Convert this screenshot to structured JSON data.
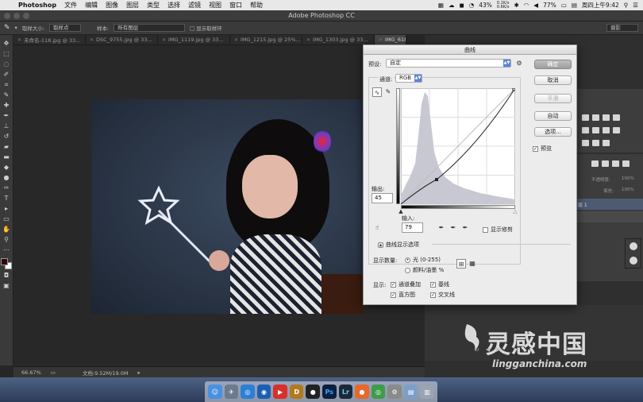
{
  "menubar": {
    "app_name": "Photoshop",
    "items": [
      "文件",
      "编辑",
      "图像",
      "图层",
      "类型",
      "选择",
      "滤镜",
      "视图",
      "窗口",
      "帮助"
    ],
    "battery_small": "43%",
    "net_up": "0.1K/s",
    "net_down": "0.6K/s",
    "battery": "77%",
    "clock": "周四上午9:42"
  },
  "titlebar": {
    "title": "Adobe Photoshop CC"
  },
  "options_bar": {
    "sample_size_label": "取样大小:",
    "sample_size_value": "取样点",
    "sample_label": "样本:",
    "sample_value": "所有图层",
    "show_ring_label": "显示取样环",
    "workspace": "摄影"
  },
  "tabs": [
    {
      "label": "未命名-118.jpg @ 33...",
      "active": false
    },
    {
      "label": "DSC_9755.jpg @ 33...",
      "active": false
    },
    {
      "label": "IMG_1119.jpg @ 33...",
      "active": false
    },
    {
      "label": "IMG_1215.jpg @ 25%...",
      "active": false
    },
    {
      "label": "IMG_1303.jpg @ 33...",
      "active": false
    },
    {
      "label": "IMG_6184.jp...",
      "active": true
    }
  ],
  "statusbar": {
    "zoom": "66.67%",
    "doc_size": "文档:9.52M/19.0M"
  },
  "panels": {
    "opacity_label": "不透明度:",
    "opacity_value": "100%",
    "fill_label": "填充:",
    "fill_value": "100%",
    "layer_name": "层 1"
  },
  "curves_dialog": {
    "title": "曲线",
    "preset_label": "预设:",
    "preset_value": "自定",
    "channel_label": "通道:",
    "channel_value": "RGB",
    "ok": "确定",
    "cancel": "取消",
    "smooth": "平滑",
    "auto": "自动",
    "options": "选项...",
    "preview_label": "预览",
    "output_label": "输出:",
    "output_value": "45",
    "input_label": "输入:",
    "input_value": "79",
    "show_clipping": "显示修剪",
    "display_options_label": "曲线显示选项",
    "show_amount_label": "显示数量:",
    "light_label": "光 (0-255)",
    "pigment_label": "颜料/油墨 %",
    "show_label": "显示:",
    "channel_overlays": "通道叠加",
    "baseline": "基线",
    "histogram": "直方图",
    "intersection": "交叉线"
  },
  "watermark": {
    "cn": "灵感中国",
    "en": "lingganchina.com"
  }
}
